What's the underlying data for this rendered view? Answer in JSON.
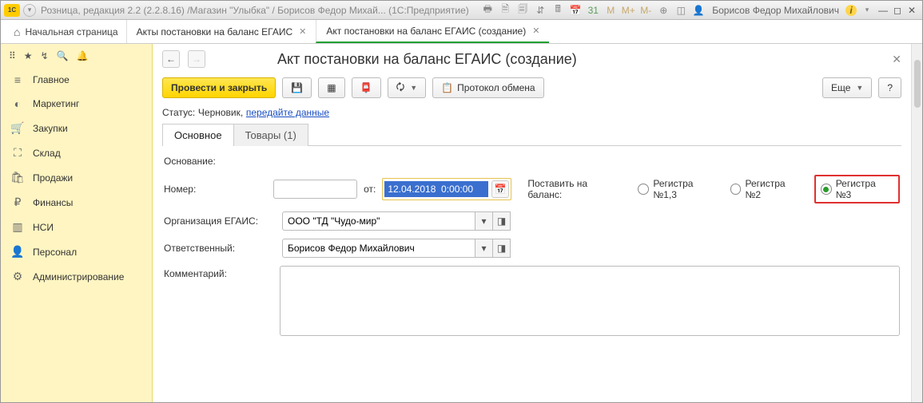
{
  "titlebar": {
    "badge": "1C",
    "title": "Розница, редакция 2.2 (2.2.8.16) /Магазин \"Улыбка\" / Борисов Федор Михай... (1С:Предприятие)",
    "m_plain": "M",
    "m_plus": "M+",
    "m_minus": "M-",
    "user": "Борисов Федор Михайлович",
    "info": "i"
  },
  "tabs": {
    "home": "Начальная страница",
    "list": "Акты постановки на баланс ЕГАИС",
    "current": "Акт постановки на баланс ЕГАИС (создание)"
  },
  "side_icons": [
    "⠿",
    "★",
    "↯",
    "🔍",
    "🔔"
  ],
  "sidebar": {
    "items": [
      {
        "icon": "≡",
        "label": "Главное"
      },
      {
        "icon": "◐",
        "label": "Маркетинг"
      },
      {
        "icon": "🛒",
        "label": "Закупки"
      },
      {
        "icon": "⛶",
        "label": "Склад"
      },
      {
        "icon": "🛍",
        "label": "Продажи"
      },
      {
        "icon": "₽",
        "label": "Финансы"
      },
      {
        "icon": "▥",
        "label": "НСИ"
      },
      {
        "icon": "👤",
        "label": "Персонал"
      },
      {
        "icon": "⚙",
        "label": "Администрирование"
      }
    ]
  },
  "page": {
    "heading": "Акт постановки на баланс ЕГАИС (создание)",
    "toolbar": {
      "commit": "Провести и закрыть",
      "proto": "Протокол обмена",
      "more": "Еще",
      "help": "?"
    },
    "status_label": "Статус:",
    "status_value": "Черновик,",
    "status_link": "передайте данные",
    "inner_tabs": {
      "main": "Основное",
      "goods": "Товары (1)"
    },
    "form": {
      "basis_label": "Основание:",
      "number_label": "Номер:",
      "number_value": "",
      "from_label": "от:",
      "date_value": "12.04.2018  0:00:00",
      "put_label": "Поставить на баланс:",
      "reg1": "Регистра №1,3",
      "reg2": "Регистра №2",
      "reg3": "Регистра №3",
      "org_label": "Организация ЕГАИС:",
      "org_value": "ООО \"ТД \"Чудо-мир\"",
      "resp_label": "Ответственный:",
      "resp_value": "Борисов Федор Михайлович",
      "comment_label": "Комментарий:",
      "comment_value": ""
    }
  }
}
